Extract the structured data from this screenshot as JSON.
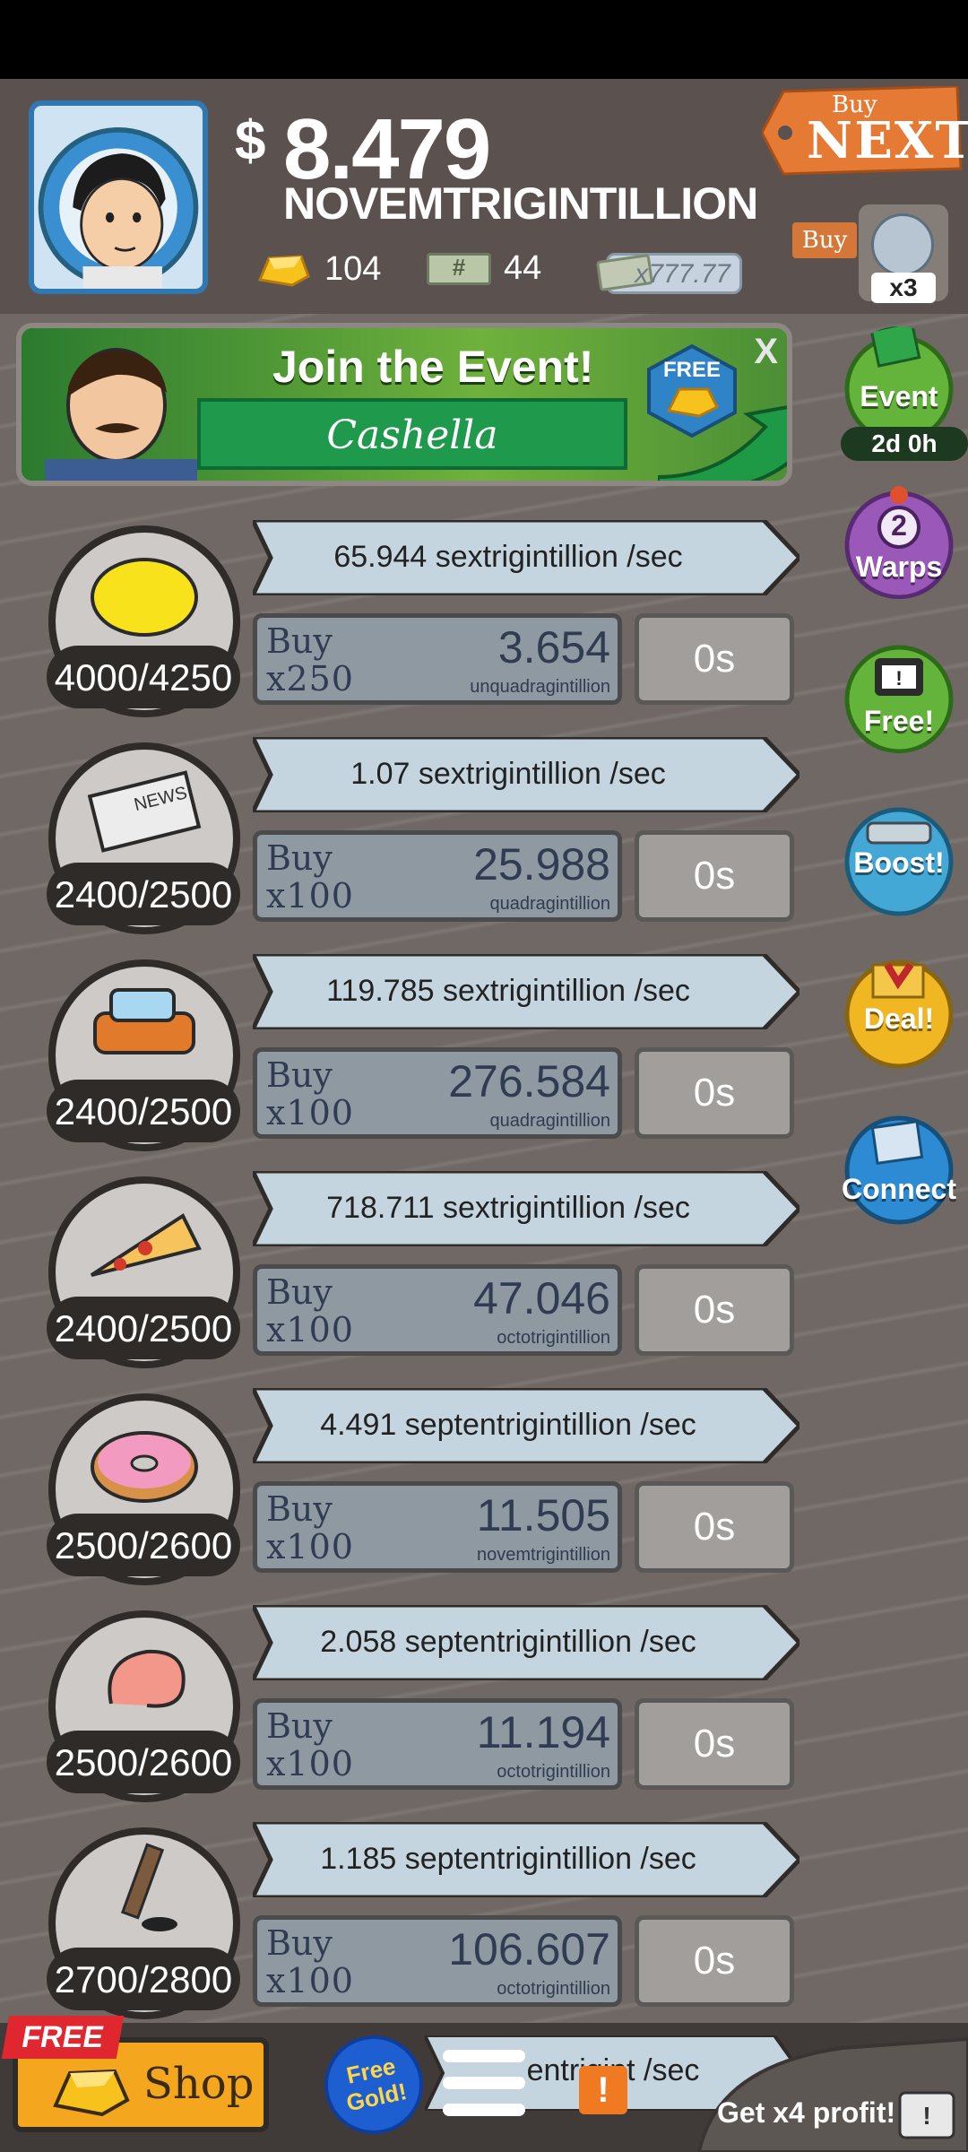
{
  "header": {
    "currency_symbol": "$",
    "cash_amount": "8.479",
    "cash_unit": "NOVEMTRIGINTILLION",
    "gold_count": "104",
    "megabucks_count": "44",
    "multiplier": "x777.77",
    "buy_next_small": "Buy",
    "buy_next_big": "NEXT",
    "buy_label": "Buy",
    "manager_count": "x3"
  },
  "event_banner": {
    "title": "Join the Event!",
    "name": "Cashella",
    "free_label": "FREE",
    "close": "X"
  },
  "side_buttons": {
    "event": {
      "label": "Event",
      "timer": "2d 0h"
    },
    "warps": {
      "count": "2",
      "label": "Warps"
    },
    "free": {
      "label": "Free!"
    },
    "boost": {
      "label": "Boost!"
    },
    "deal": {
      "label": "Deal!"
    },
    "connect": {
      "label": "Connect"
    }
  },
  "businesses": [
    {
      "icon": "lemon-icon",
      "counter": "4000/4250",
      "rate": "65.944 sextrigintillion /sec",
      "buy": "Buy",
      "qty": "x250",
      "cost": "3.654",
      "cost_unit": "unquadragintillion",
      "timer": "0s"
    },
    {
      "icon": "newspaper-icon",
      "counter": "2400/2500",
      "rate": "1.07 sextrigintillion /sec",
      "buy": "Buy",
      "qty": "x100",
      "cost": "25.988",
      "cost_unit": "quadragintillion",
      "timer": "0s"
    },
    {
      "icon": "car-icon",
      "counter": "2400/2500",
      "rate": "119.785 sextrigintillion /sec",
      "buy": "Buy",
      "qty": "x100",
      "cost": "276.584",
      "cost_unit": "quadragintillion",
      "timer": "0s"
    },
    {
      "icon": "pizza-icon",
      "counter": "2400/2500",
      "rate": "718.711 sextrigintillion /sec",
      "buy": "Buy",
      "qty": "x100",
      "cost": "47.046",
      "cost_unit": "octotrigintillion",
      "timer": "0s"
    },
    {
      "icon": "donut-icon",
      "counter": "2500/2600",
      "rate": "4.491 septentrigintillion /sec",
      "buy": "Buy",
      "qty": "x100",
      "cost": "11.505",
      "cost_unit": "novemtrigintillion",
      "timer": "0s"
    },
    {
      "icon": "shrimp-icon",
      "counter": "2500/2600",
      "rate": "2.058 septentrigintillion /sec",
      "buy": "Buy",
      "qty": "x100",
      "cost": "11.194",
      "cost_unit": "octotrigintillion",
      "timer": "0s"
    },
    {
      "icon": "hockey-icon",
      "counter": "2700/2800",
      "rate": "1.185 septentrigintillion /sec",
      "buy": "Buy",
      "qty": "x100",
      "cost": "106.607",
      "cost_unit": "octotrigintillion",
      "timer": "0s"
    }
  ],
  "bottom": {
    "free_ribbon": "FREE",
    "shop": "Shop",
    "free_gold": "Free Gold!",
    "alert": "!",
    "peek_text": "entrigint /sec",
    "x4": "Get x4 profit!"
  },
  "colors": {
    "background": "#6f6864",
    "topbar": "#5b524f",
    "shop": "#f4a61e",
    "event_green": "#1f9a4c"
  }
}
